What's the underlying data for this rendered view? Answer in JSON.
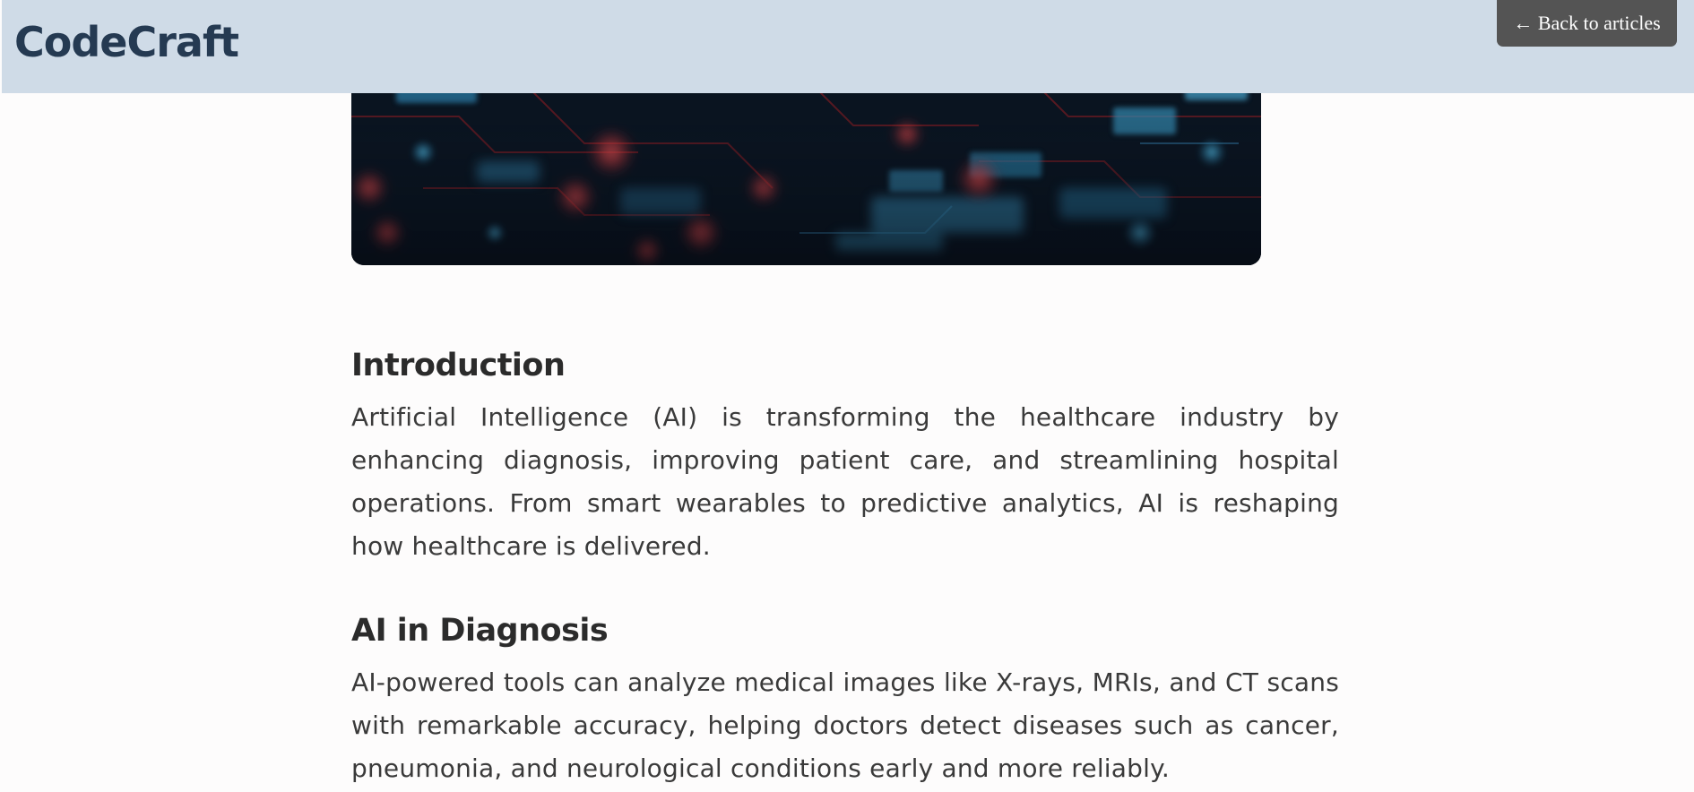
{
  "header": {
    "logo": "CodeCraft",
    "back_button_label": "← Back to articles"
  },
  "hero": {
    "icon": "circuit-board-image",
    "colors": {
      "base": "#08111b",
      "blue": "#3fa9d9",
      "red": "#e33d3d"
    }
  },
  "article": {
    "sections": [
      {
        "heading": "Introduction",
        "body": "Artificial Intelligence (AI) is transforming the healthcare industry by enhancing diagnosis, improving patient care, and streamlining hospital operations. From smart wearables to predictive analytics, AI is reshaping how healthcare is delivered."
      },
      {
        "heading": "AI in Diagnosis",
        "body": "AI-powered tools can analyze medical images like X-rays, MRIs, and CT scans with remarkable accuracy, helping doctors detect diseases such as cancer, pneumonia, and neurological conditions early and more reliably."
      }
    ]
  },
  "theme": {
    "header_bg": "#cfdbe7",
    "logo_color": "#253a52",
    "button_bg": "#545454"
  }
}
